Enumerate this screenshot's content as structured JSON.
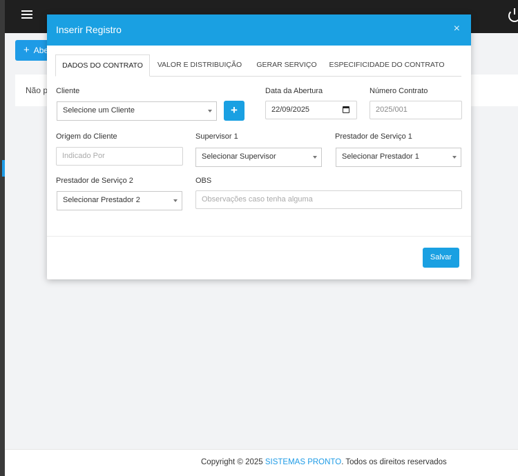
{
  "background": {
    "new_button_label": "Abe",
    "card_text": "Não po"
  },
  "footer": {
    "prefix": "Copyright © 2025 ",
    "brand": "SISTEMAS PRONTO",
    "suffix": ". Todos os direitos reservados"
  },
  "modal": {
    "title": "Inserir Registro",
    "close": "×",
    "tabs": [
      {
        "label": "DADOS DO CONTRATO",
        "active": true
      },
      {
        "label": "VALOR E DISTRIBUIÇÃO",
        "active": false
      },
      {
        "label": "GERAR SERVIÇO",
        "active": false
      },
      {
        "label": "ESPECIFICIDADE DO CONTRATO",
        "active": false
      }
    ],
    "form": {
      "cliente_label": "Cliente",
      "cliente_value": "Selecione um Cliente",
      "add_cliente": "+",
      "data_abertura_label": "Data da Abertura",
      "data_abertura_value": "22/09/2025",
      "numero_contrato_label": "Número Contrato",
      "numero_contrato_placeholder": "2025/001",
      "origem_label": "Origem do Cliente",
      "origem_placeholder": "Indicado Por",
      "supervisor_label": "Supervisor 1",
      "supervisor_value": "Selecionar Supervisor",
      "prestador1_label": "Prestador de Serviço 1",
      "prestador1_value": "Selecionar Prestador 1",
      "prestador2_label": "Prestador de Serviço 2",
      "prestador2_value": "Selecionar Prestador 2",
      "obs_label": "OBS",
      "obs_placeholder": "Observações caso tenha alguma"
    },
    "save_label": "Salvar"
  },
  "colors": {
    "accent": "#1aa0e2",
    "topbar": "#1f1f1f"
  }
}
